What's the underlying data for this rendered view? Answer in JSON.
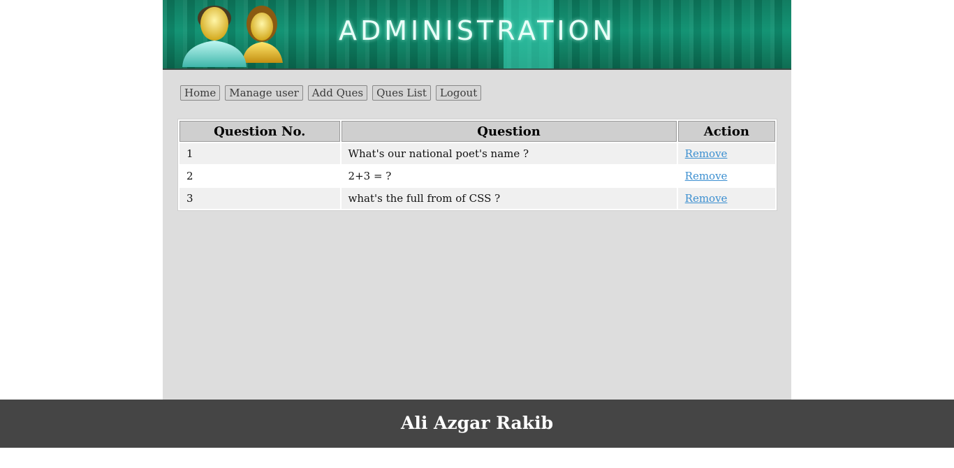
{
  "header": {
    "title": "ADMINISTRATION",
    "icon": "users-icon"
  },
  "nav": {
    "items": [
      {
        "label": "Home"
      },
      {
        "label": "Manage user"
      },
      {
        "label": "Add Ques"
      },
      {
        "label": "Ques List"
      },
      {
        "label": "Logout"
      }
    ]
  },
  "table": {
    "columns": [
      "Question No.",
      "Question",
      "Action"
    ],
    "rows": [
      {
        "no": "1",
        "question": "What's our national poet's name ?",
        "action": "Remove"
      },
      {
        "no": "2",
        "question": "2+3 = ?",
        "action": "Remove"
      },
      {
        "no": "3",
        "question": "what's the full from of CSS ?",
        "action": "Remove"
      }
    ]
  },
  "footer": {
    "text": "Ali Azgar Rakib"
  },
  "colors": {
    "banner": "#0f9272",
    "page_bg": "#dddddd",
    "footer_bg": "#454545",
    "link": "#3c8fd0"
  }
}
